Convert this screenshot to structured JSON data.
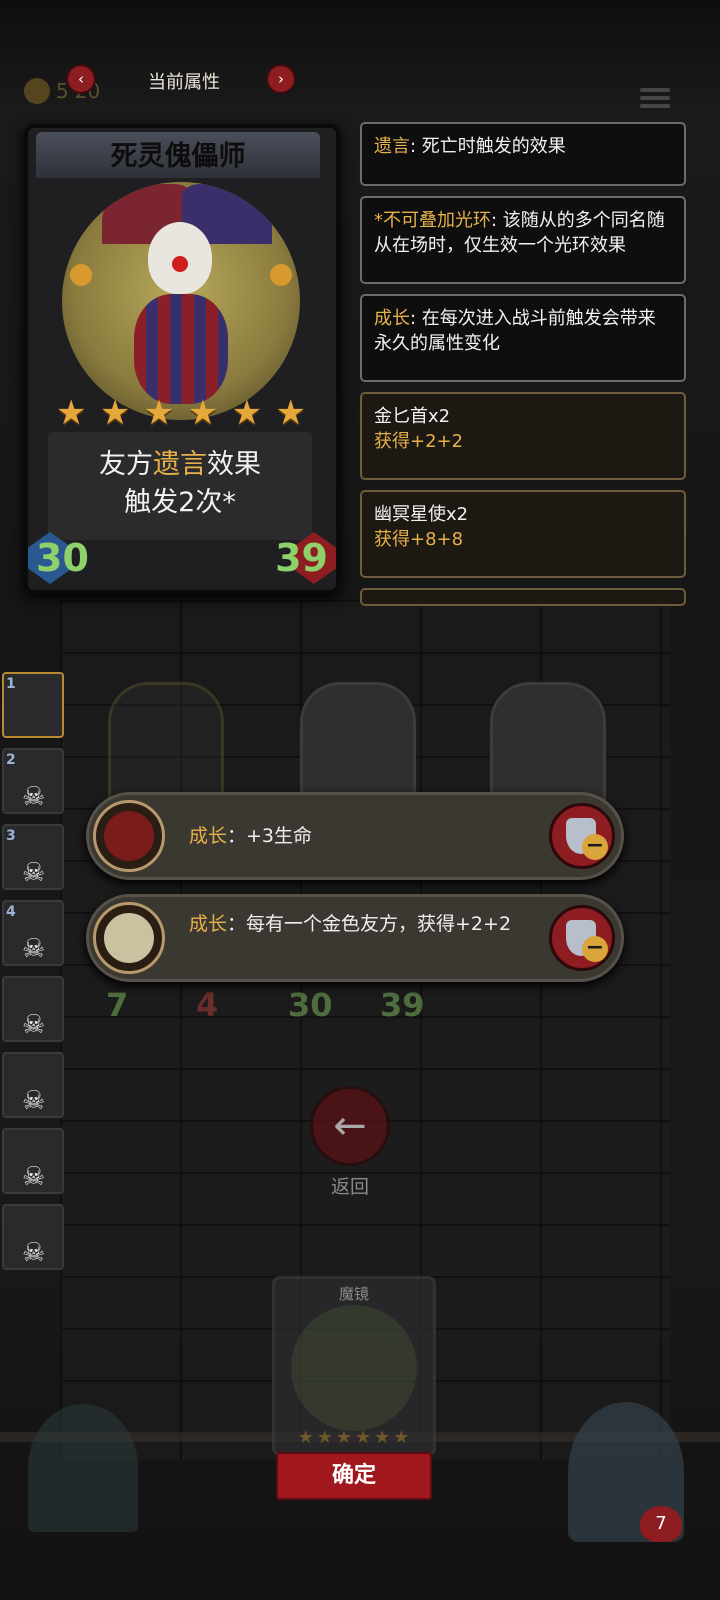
{
  "header": {
    "title": "当前属性",
    "prev_icon": "chevron-left-icon",
    "next_icon": "chevron-right-icon"
  },
  "top_bar": {
    "gold_value": "5",
    "gold_max": "20"
  },
  "hero_card": {
    "name": "死灵傀儡师",
    "stars": 6,
    "desc_prefix": "友方",
    "desc_keyword": "遗言",
    "desc_suffix": "效果",
    "desc_line2": "触发2次*",
    "attack": "30",
    "health": "39"
  },
  "info_boxes": [
    {
      "keyword": "遗言",
      "text": ": 死亡时触发的效果"
    },
    {
      "keyword": "*不可叠加光环",
      "text": ": 该随从的多个同名随从在场时，仅生效一个光环效果"
    },
    {
      "keyword": "成长",
      "text": ": 在每次进入战斗前触发会带来永久的属性变化"
    }
  ],
  "item_boxes": [
    {
      "name": "金匕首x2",
      "gain": "获得+2+2"
    },
    {
      "name": "幽冥星使x2",
      "gain": "获得+8+8"
    }
  ],
  "roster": [
    "1",
    "2",
    "3",
    "4"
  ],
  "effects": [
    {
      "keyword": "成长",
      "text": "：+3生命"
    },
    {
      "keyword": "成长",
      "text": "：每有一个金色友方，获得+2+2"
    }
  ],
  "board_stats": {
    "left_atk": "7",
    "left_hp": "4",
    "mid_atk": "30",
    "mid_hp": "39"
  },
  "back_label": "返回",
  "mirror_card": {
    "name": "魔镜",
    "stars": "★★★★★★"
  },
  "confirm_label": "确定",
  "player_hp": "7",
  "colors": {
    "accent_red": "#8d1d21",
    "keyword_gold": "#e7b14a",
    "stat_green": "#8ed06a"
  }
}
